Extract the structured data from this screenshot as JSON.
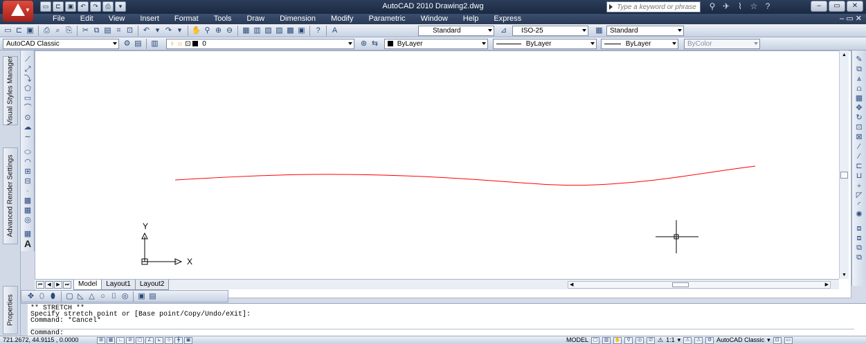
{
  "window": {
    "title": "AutoCAD 2010    Drawing2.dwg",
    "search_placeholder": "Type a keyword or phrase",
    "controls": [
      "–",
      "▭",
      "✕"
    ]
  },
  "menu": {
    "items": [
      "File",
      "Edit",
      "View",
      "Insert",
      "Format",
      "Tools",
      "Draw",
      "Dimension",
      "Modify",
      "Parametric",
      "Window",
      "Help",
      "Express"
    ],
    "right_controls": "– ▭ ✕"
  },
  "toolbars": {
    "text_style": "Standard",
    "dim_style": "ISO-25",
    "table_style": "Standard",
    "workspace": "AutoCAD Classic",
    "layer": "0",
    "color": "ByLayer",
    "linetype": "ByLayer",
    "lineweight": "ByLayer",
    "plot_style": "ByColor"
  },
  "palettes": {
    "tabs": [
      "Visual Styles Manager",
      "Advanced Render Settings",
      "Properties"
    ]
  },
  "canvas": {
    "ucs_x_label": "X",
    "ucs_y_label": "Y",
    "spline_color": "#ff0000"
  },
  "layout_tabs": [
    "Model",
    "Layout1",
    "Layout2"
  ],
  "command": {
    "history": [
      "** STRETCH **",
      "Specify stretch point or [Base point/Copy/Undo/eXit]:",
      "Command: *Cancel*"
    ],
    "prompt": "Command:"
  },
  "status": {
    "coordinates": "721.2672, 44.9115 , 0.0000",
    "space": "MODEL",
    "annotation_scale": "1:1",
    "workspace": "AutoCAD Classic"
  }
}
